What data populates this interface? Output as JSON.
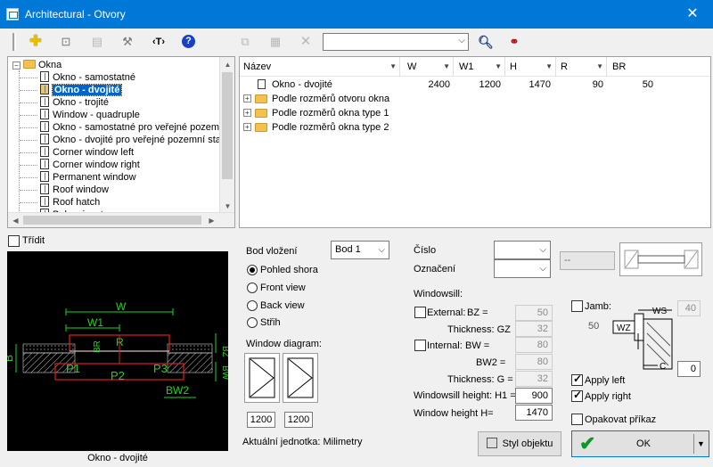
{
  "window": {
    "title": "Architectural - Otvory",
    "close_glyph": "✕"
  },
  "toolbar": {
    "search_value": "",
    "icons": [
      "add-icon",
      "dimension-icon",
      "list-icon",
      "tools-icon",
      "text-tag-icon",
      "help-icon",
      "copy-icon",
      "table-icon",
      "delete-icon",
      "search-icon",
      "binoculars-icon"
    ]
  },
  "tree": {
    "root": "Okna",
    "items": [
      "Okno - samostatné",
      "Okno - dvojité",
      "Okno - trojité",
      "Window - quadruple",
      "Okno - samostatné pro veřejné pozemní stavby",
      "Okno - dvojité pro veřejné pozemní stavby",
      "Corner window left",
      "Corner window right",
      "Permanent window",
      "Roof window",
      "Roof hatch",
      "Balconies, terraces"
    ],
    "selected_index": 1
  },
  "grid": {
    "columns": [
      "Název",
      "W",
      "W1",
      "H",
      "R",
      "BR"
    ],
    "rows": [
      {
        "name": "Okno - dvojité",
        "W": "2400",
        "W1": "1200",
        "H": "1470",
        "R": "90",
        "BR": "50"
      }
    ],
    "groups": [
      "Podle rozměrů otvoru okna",
      "Podle rozměrů okna type 1",
      "Podle rozměrů okna type 2"
    ]
  },
  "sort_label": "Třídit",
  "preview": {
    "caption": "Okno - dvojité",
    "labels": {
      "W": "W",
      "W1": "W1",
      "R": "R",
      "BR": "BR",
      "BZ": "BZ",
      "B": "B",
      "P1": "P1",
      "P2": "P2",
      "P3": "P3",
      "BW": "BW",
      "BW2": "BW2"
    }
  },
  "insertion": {
    "label": "Bod vložení",
    "value": "Bod 1"
  },
  "views": {
    "options": [
      "Pohled shora",
      "Front view",
      "Back view",
      "Střih"
    ],
    "selected": 0
  },
  "window_diagram": {
    "label": "Window diagram:",
    "widths": [
      "1200",
      "1200"
    ]
  },
  "units_label": "Aktuální jednotka: Milimetry",
  "number_label": "Číslo",
  "mark_label": "Označení",
  "gray_combo_value": "--",
  "windowsill": {
    "label": "Windowsill:",
    "external_label": "External:",
    "bz_label": "BZ =",
    "bz_value": "50",
    "thickness_gz_label": "Thickness: GZ",
    "thickness_gz_value": "32",
    "internal_label": "Internal:",
    "bw_label": "BW =",
    "bw_value": "80",
    "bw2_label": "BW2 =",
    "bw2_value": "80",
    "thickness_g_label": "Thickness: G =",
    "thickness_g_value": "32",
    "height_h1_label": "Windowsill height: H1 =",
    "height_h1_value": "900",
    "window_height_label": "Window height H=",
    "window_height_value": "1470"
  },
  "jamb": {
    "label": "Jamb:",
    "ws_label": "WS",
    "ws_value": "40",
    "wz_label": "WZ",
    "left_value": "50",
    "c_label": "C",
    "c_value": "0"
  },
  "apply_left": "Apply left",
  "apply_right": "Apply right",
  "repeat_label": "Opakovat příkaz",
  "style_button": "Styl objektu",
  "ok_button": "OK"
}
